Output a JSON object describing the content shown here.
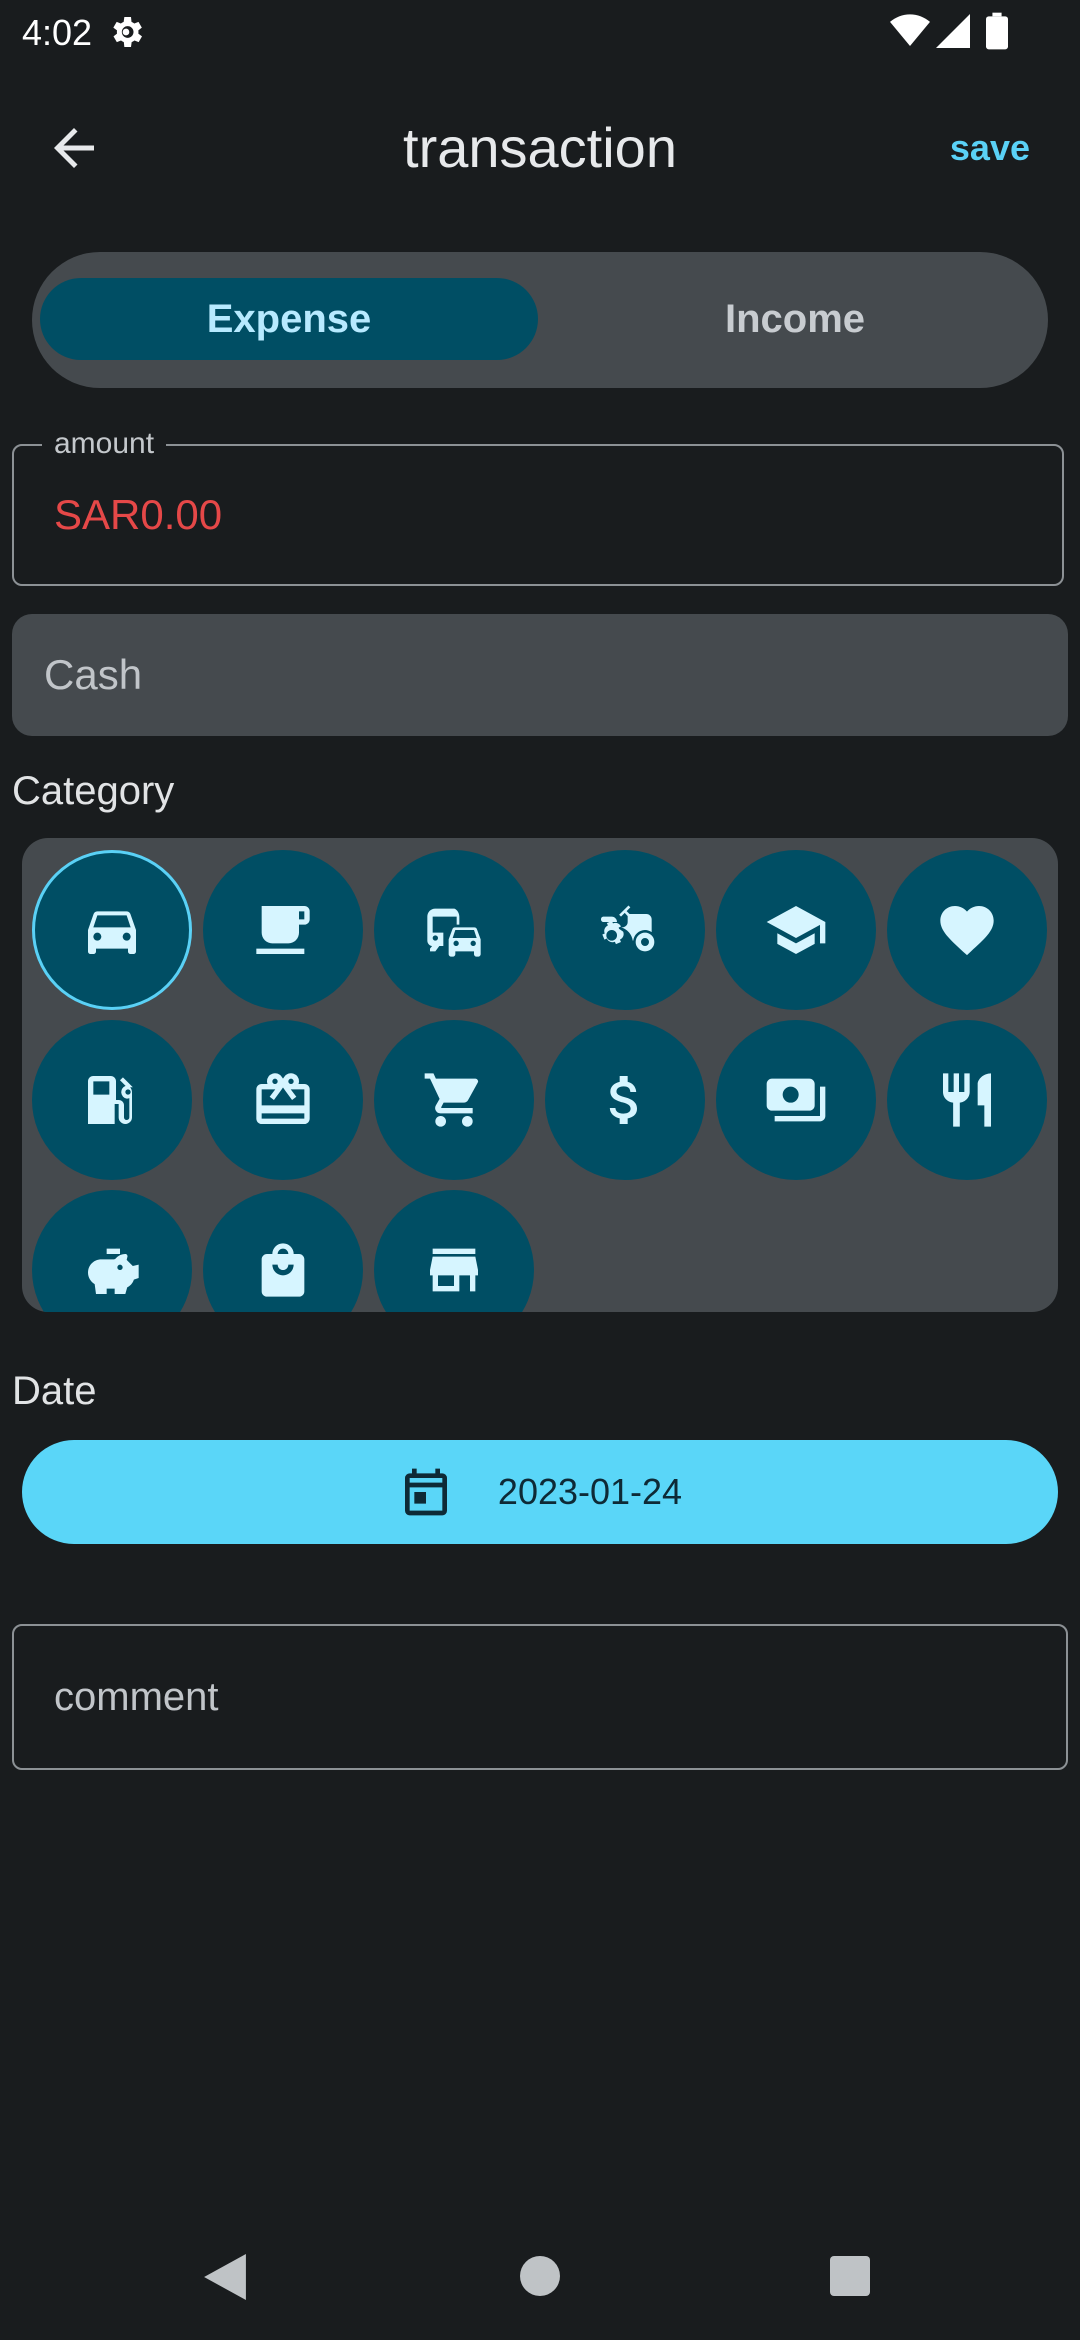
{
  "status_bar": {
    "time": "4:02",
    "icons": [
      "settings-gear-icon",
      "wifi-icon",
      "cell-signal-icon",
      "battery-icon"
    ]
  },
  "app_bar": {
    "back_icon": "arrow-back-icon",
    "title": "transaction",
    "save_label": "save"
  },
  "type_toggle": {
    "options": [
      "Expense",
      "Income"
    ],
    "selected": "Expense"
  },
  "amount": {
    "label": "amount",
    "value": "SAR0.00"
  },
  "account": {
    "value": "Cash"
  },
  "category": {
    "label": "Category",
    "icons": [
      "car-icon",
      "coffee-cup-icon",
      "commute-icon",
      "tractor-icon",
      "graduation-cap-icon",
      "heart-icon",
      "gas-station-icon",
      "gift-card-icon",
      "shopping-cart-icon",
      "dollar-icon",
      "money-bills-icon",
      "restaurant-icon",
      "piggy-bank-icon",
      "shopping-bag-icon",
      "storefront-icon"
    ],
    "selected": "car-icon"
  },
  "date": {
    "label": "Date",
    "icon": "calendar-icon",
    "value": "2023-01-24"
  },
  "comment": {
    "placeholder": "comment"
  },
  "nav_bar": {
    "icons": [
      "nav-back-icon",
      "nav-home-icon",
      "nav-recents-icon"
    ]
  },
  "colors": {
    "background": "#191c1e",
    "accent": "#5ad1f6",
    "chip": "#004e64",
    "surface": "#454a4e",
    "amount_text": "#e54848"
  }
}
